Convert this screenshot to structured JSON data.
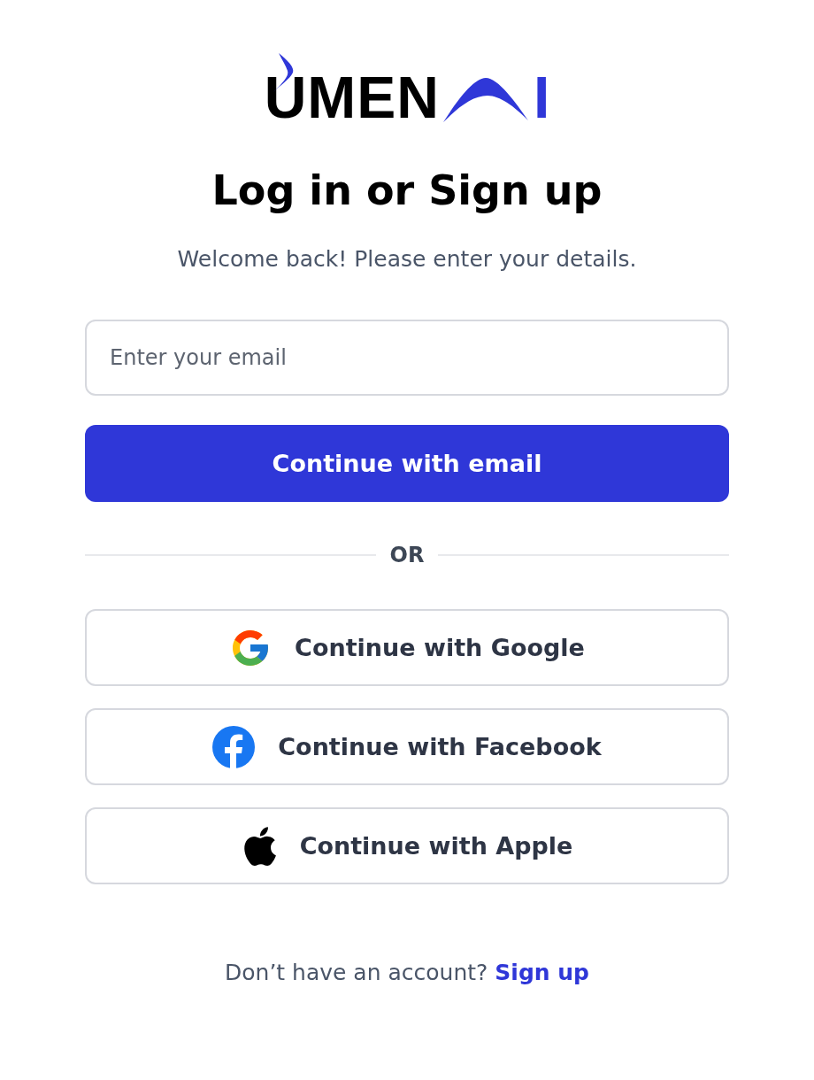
{
  "logo": {
    "letters": "UMEN",
    "tail": "I"
  },
  "title": "Log in or Sign up",
  "subtitle": "Welcome back! Please enter your details.",
  "email": {
    "placeholder": "Enter your email"
  },
  "primary_button": "Continue with email",
  "divider": "OR",
  "social_buttons": [
    {
      "kind": "google",
      "label": "Continue with Google"
    },
    {
      "kind": "facebook",
      "label": "Continue with Facebook"
    },
    {
      "kind": "apple",
      "label": "Continue with Apple"
    }
  ],
  "footer": {
    "text": "Don’t have an account?",
    "link": "Sign up"
  }
}
